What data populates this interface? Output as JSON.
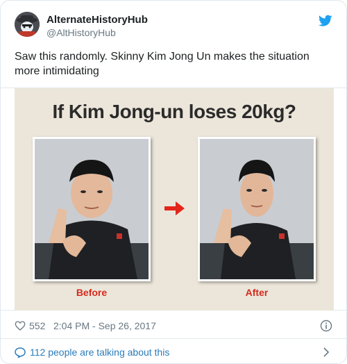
{
  "account": {
    "display_name": "AlternateHistoryHub",
    "handle": "@AltHistoryHub"
  },
  "tweet": {
    "text": "Saw this randomly. Skinny Kim Jong Un makes the situation more intimidating"
  },
  "image": {
    "title": "If Kim Jong-un loses 20kg?",
    "before_label": "Before",
    "after_label": "After"
  },
  "footer": {
    "like_count": "552",
    "timestamp": "2:04 PM - Sep 26, 2017"
  },
  "conversation": {
    "label": "112 people are talking about this"
  },
  "colors": {
    "link_blue": "#2b7bb9",
    "twitter_blue": "#1da1f2",
    "caption_red": "#d42a1c",
    "meme_background": "#ece6da"
  },
  "icons": {
    "brand": "twitter-bird-icon",
    "like": "heart-icon",
    "info": "info-icon",
    "reply": "speech-bubble-icon",
    "more": "chevron-right-icon"
  }
}
